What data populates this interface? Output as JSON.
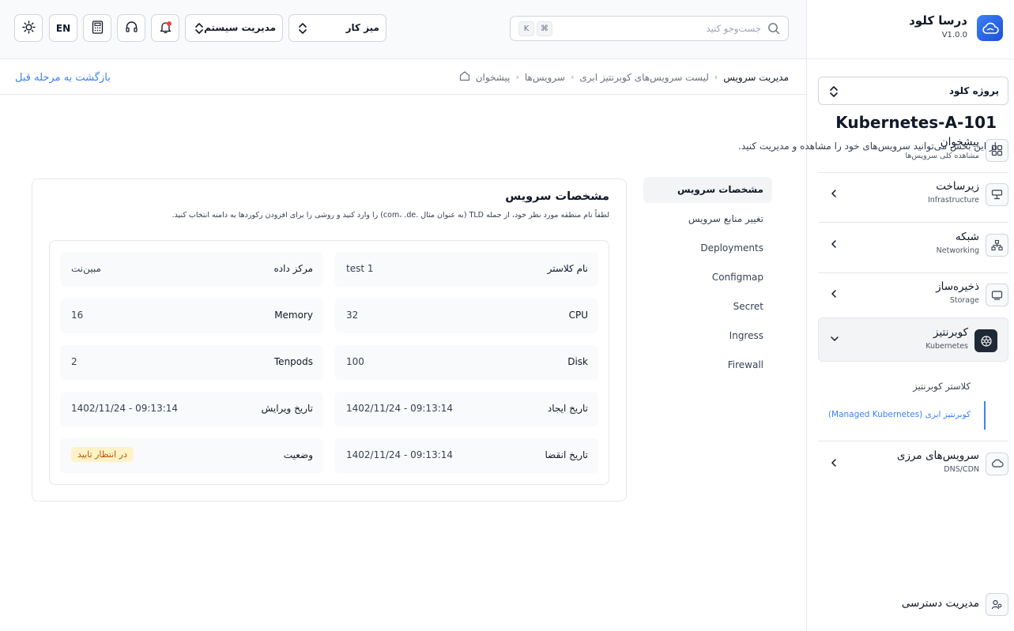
{
  "brand": {
    "name": "درسا کلود",
    "version": "V1.0.0"
  },
  "project": {
    "label": "پروژه کلود"
  },
  "sidebar": {
    "items": [
      {
        "title": "پیشخوان",
        "subtitle": "مشاهده کلی سرویس‌ها"
      },
      {
        "title": "زیرساخت",
        "subtitle": "Infrastructure"
      },
      {
        "title": "شبکه",
        "subtitle": "Networking"
      },
      {
        "title": "ذخیره‌ساز",
        "subtitle": "Storage"
      },
      {
        "title": "کوبرنتیز",
        "subtitle": "Kubernetes"
      },
      {
        "title": "سرویس‌های مرزی",
        "subtitle": "DNS/CDN"
      }
    ],
    "kubernetes_sub": [
      "کلاستر کوبرنتیز",
      "کوبرنتیز ابری (Managed Kubernetes)"
    ],
    "access": "مدیریت دسترسی"
  },
  "header": {
    "search_placeholder": "جست‌وجو کنید",
    "kbd_k": "K",
    "kbd_cmd": "⌘",
    "workspace": "میز کار",
    "system_admin": "مدیریت سیستم",
    "lang": "EN"
  },
  "breadcrumb": {
    "items": [
      "پیشخوان",
      "سرویس‌ها",
      "لیست سرویس‌های کوبرنتیز ابری",
      "مدیریت سرویس"
    ],
    "back": "بازگشت به مرحله قبل"
  },
  "page": {
    "title": "Kubernetes-A-101",
    "description": "از این بخش می‌توانید سرویس‌های خود را مشاهده و مدیریت کنید."
  },
  "tabs": [
    "مشخصات سرویس",
    "تغییر منابع سرویس",
    "Deployments",
    "Configmap",
    "Secret",
    "Ingress",
    "Firewall"
  ],
  "card": {
    "title": "مشخصات سرویس",
    "description": "لطفاً نام منطقه مورد نظر خود، از جمله TLD (به عنوان مثال .com، .de) را وارد کنید و روشی را برای افزودن رکوردها به دامنه انتخاب کنید.",
    "fields": {
      "cluster_name": {
        "k": "نام کلاستر",
        "v": "test 1"
      },
      "datacenter": {
        "k": "مرکز داده",
        "v": "مبین‌نت"
      },
      "cpu": {
        "k": "CPU",
        "v": "32"
      },
      "memory": {
        "k": "Memory",
        "v": "16"
      },
      "disk": {
        "k": "Disk",
        "v": "100"
      },
      "tenpods": {
        "k": "Tenpods",
        "v": "2"
      },
      "created": {
        "k": "تاریخ ایجاد",
        "v": "1402/11/24 - 09:13:14"
      },
      "edited": {
        "k": "تاریخ ویرایش",
        "v": "1402/11/24 - 09:13:14"
      },
      "expires": {
        "k": "تاریخ انقضا",
        "v": "1402/11/24 - 09:13:14"
      },
      "status": {
        "k": "وضعیت",
        "v": "در انتظار تایید"
      }
    }
  },
  "colors": {
    "accent": "#3b82f6",
    "status_bg": "#fef3c7",
    "status_fg": "#b45309"
  }
}
